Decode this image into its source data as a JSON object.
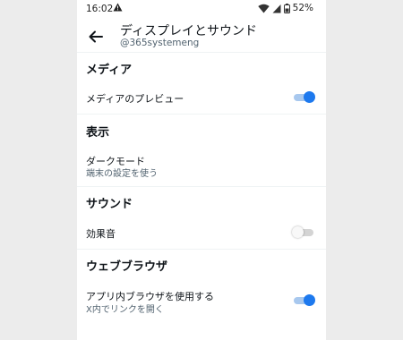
{
  "status_bar": {
    "time": "16:02",
    "battery": "52%"
  },
  "header": {
    "title": "ディスプレイとサウンド",
    "subtitle": "@365systemeng"
  },
  "sections": {
    "media": {
      "title": "メディア",
      "preview_label": "メディアのプレビュー",
      "preview_enabled": true
    },
    "display": {
      "title": "表示",
      "dark_mode_label": "ダークモード",
      "dark_mode_value": "端末の設定を使う"
    },
    "sound": {
      "title": "サウンド",
      "effects_label": "効果音",
      "effects_enabled": false
    },
    "browser": {
      "title": "ウェブブラウザ",
      "in_app_label": "アプリ内ブラウザを使用する",
      "in_app_sub": "X内でリンクを開く",
      "in_app_enabled": true
    }
  },
  "colors": {
    "accent": "#1d79ee",
    "accent_track": "#a8c8ee",
    "secondary_text": "#536471"
  }
}
